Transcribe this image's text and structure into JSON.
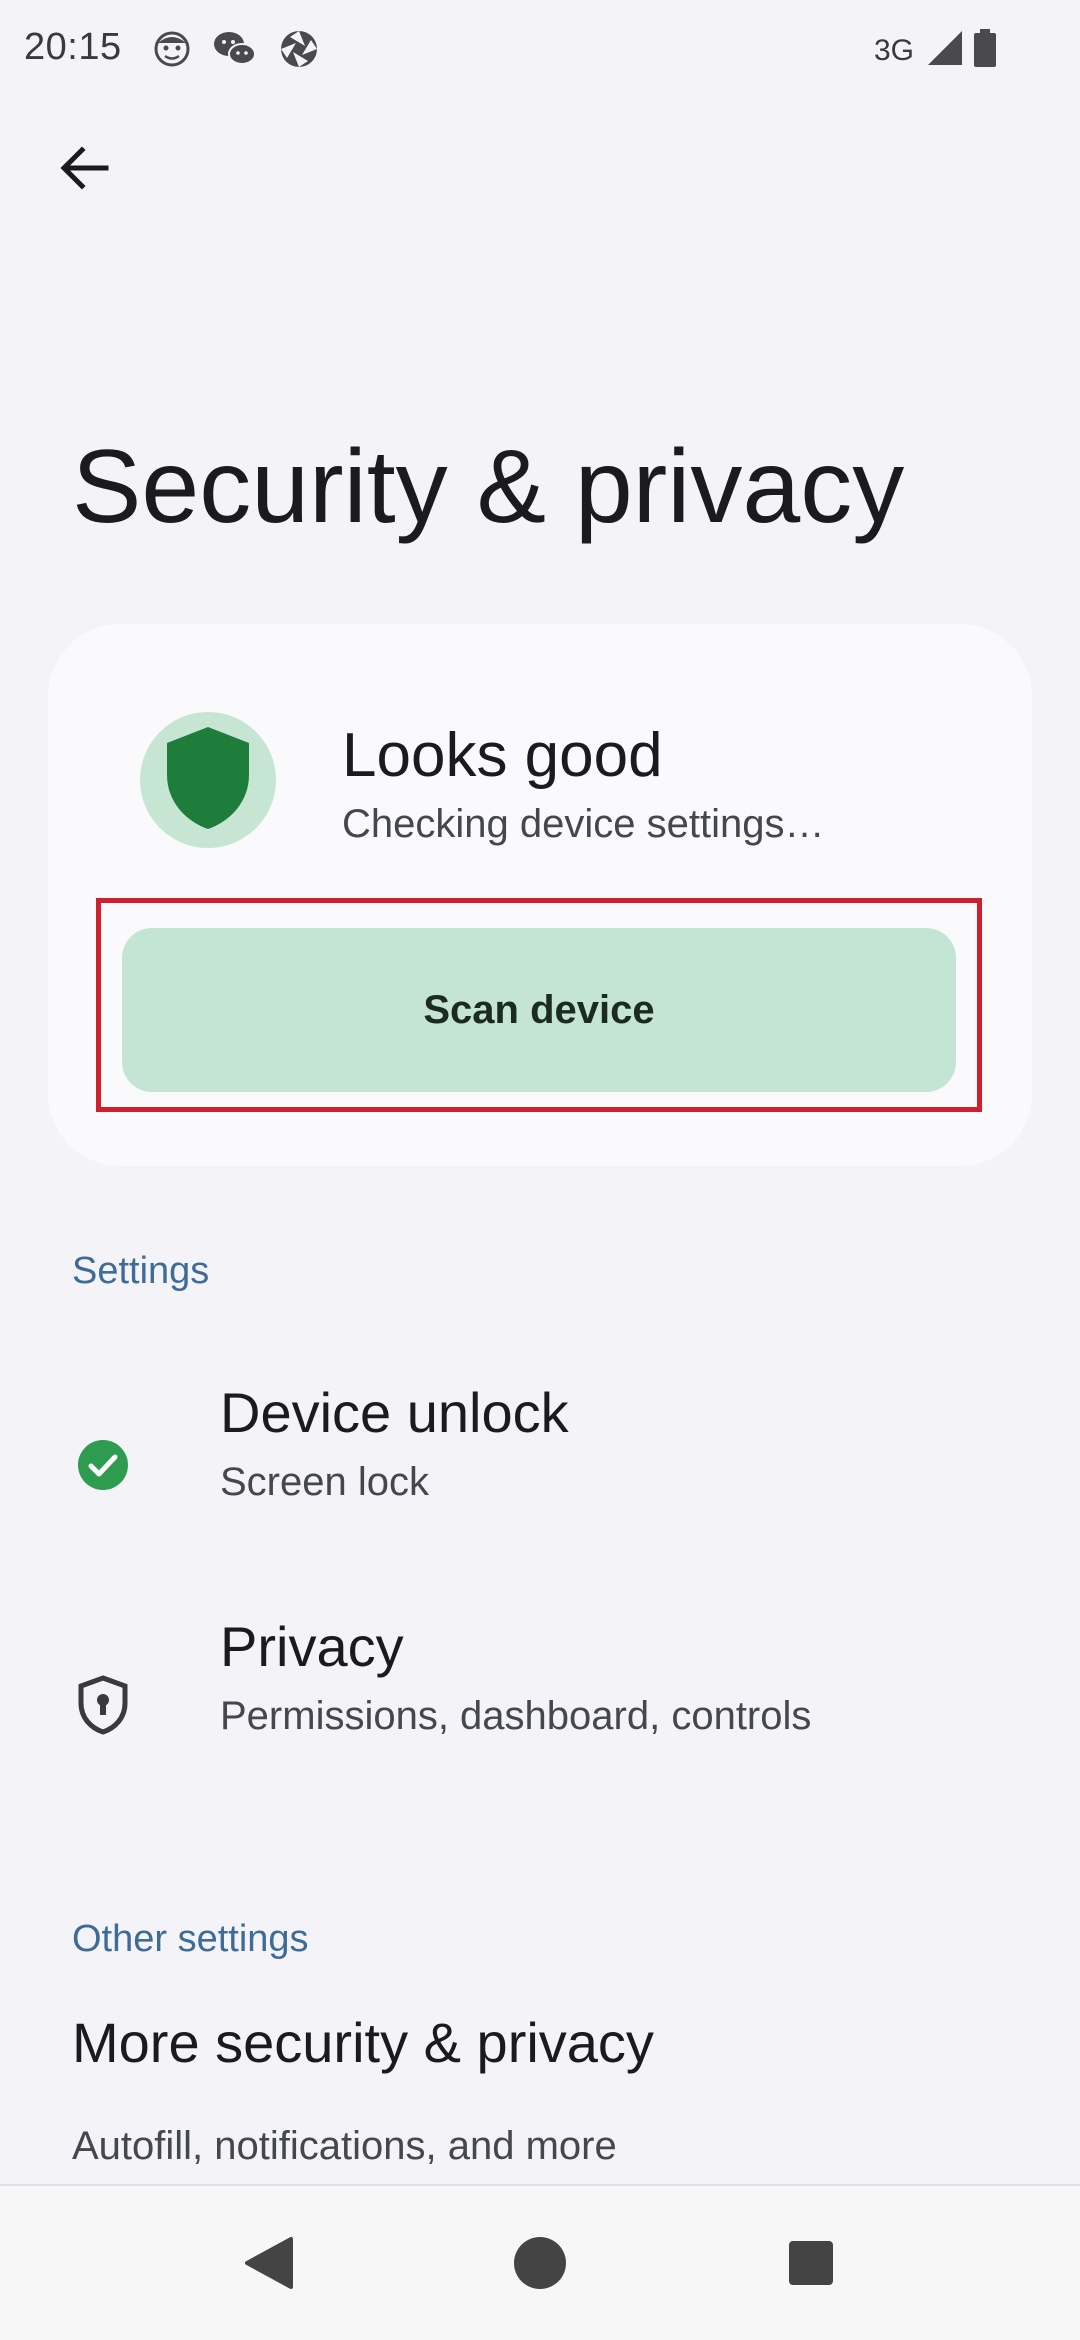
{
  "status_bar": {
    "time": "20:15",
    "network": "3G",
    "left_icons": [
      "face-icon",
      "wechat-icon",
      "aperture-icon"
    ],
    "right_icons": [
      "signal-icon",
      "battery-icon"
    ]
  },
  "header": {
    "back_icon": "arrow-left-icon",
    "title": "Security & privacy"
  },
  "status_card": {
    "icon": "shield-icon",
    "title": "Looks good",
    "subtitle": "Checking device settings…",
    "button_label": "Scan device"
  },
  "sections": {
    "settings_header": "Settings",
    "other_header": "Other settings"
  },
  "items": {
    "device_unlock": {
      "icon": "check-circle-icon",
      "title": "Device unlock",
      "summary": "Screen lock"
    },
    "privacy": {
      "icon": "shield-lock-icon",
      "title": "Privacy",
      "summary": "Permissions, dashboard, controls"
    },
    "more": {
      "title": "More security & privacy",
      "summary": "Autofill, notifications, and more"
    }
  },
  "nav_bar": {
    "back": "triangle-back-icon",
    "home": "circle-home-icon",
    "recents": "square-recents-icon"
  },
  "colors": {
    "background": "#f3f3f8",
    "card": "#fafafd",
    "accent_green": "#1e7d3a",
    "button_fill": "#c4e5d4",
    "section_header": "#3e6c96",
    "highlight_red": "#d0202f"
  }
}
